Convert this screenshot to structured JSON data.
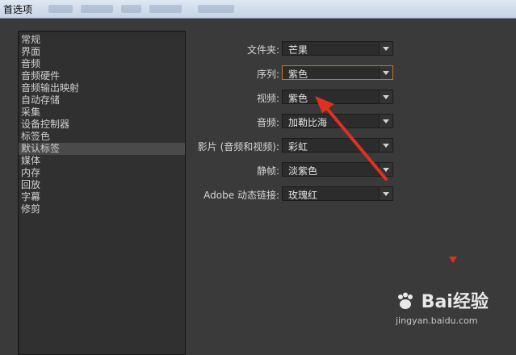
{
  "window": {
    "title": "首选项"
  },
  "sidebar": {
    "items": [
      {
        "label": "常规"
      },
      {
        "label": "界面"
      },
      {
        "label": "音频"
      },
      {
        "label": "音频硬件"
      },
      {
        "label": "音频输出映射"
      },
      {
        "label": "自动存储"
      },
      {
        "label": "采集"
      },
      {
        "label": "设备控制器"
      },
      {
        "label": "标签色"
      },
      {
        "label": "默认标签"
      },
      {
        "label": "媒体"
      },
      {
        "label": "内存"
      },
      {
        "label": "回放"
      },
      {
        "label": "字幕"
      },
      {
        "label": "修剪"
      }
    ],
    "selected_index": 9
  },
  "settings": [
    {
      "label": "文件夹:",
      "value": "芒果"
    },
    {
      "label": "序列:",
      "value": "紫色",
      "focused": true
    },
    {
      "label": "视频:",
      "value": "紫色"
    },
    {
      "label": "音频:",
      "value": "加勒比海"
    },
    {
      "label": "影片 (音频和视频):",
      "value": "彩虹"
    },
    {
      "label": "静帧:",
      "value": "淡紫色"
    },
    {
      "label": "Adobe 动态链接:",
      "value": "玫瑰红"
    }
  ],
  "watermark": {
    "logo": "Bai经验",
    "url": "jingyan.baidu.com"
  },
  "colors": {
    "annotation_arrow": "#e0301e",
    "focus_border": "#c07a28"
  }
}
